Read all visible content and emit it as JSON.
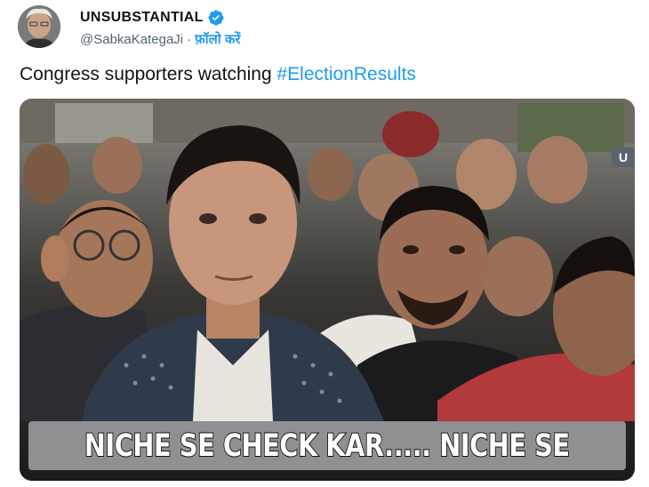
{
  "author": {
    "display_name": "UNSUBSTANTIAL",
    "handle": "@SabkaKategaJi",
    "separator": "·",
    "follow_label": "फ़ॉलो करें"
  },
  "tweet": {
    "text_prefix": "Congress supporters watching ",
    "hashtag": "#ElectionResults"
  },
  "media": {
    "caption": "NICHE SE CHECK KAR..... NICHE SE",
    "side_badge": "U"
  },
  "colors": {
    "link": "#1d9bf0",
    "verified": "#1d9bf0",
    "text": "#0f1419",
    "secondary": "#536471"
  }
}
